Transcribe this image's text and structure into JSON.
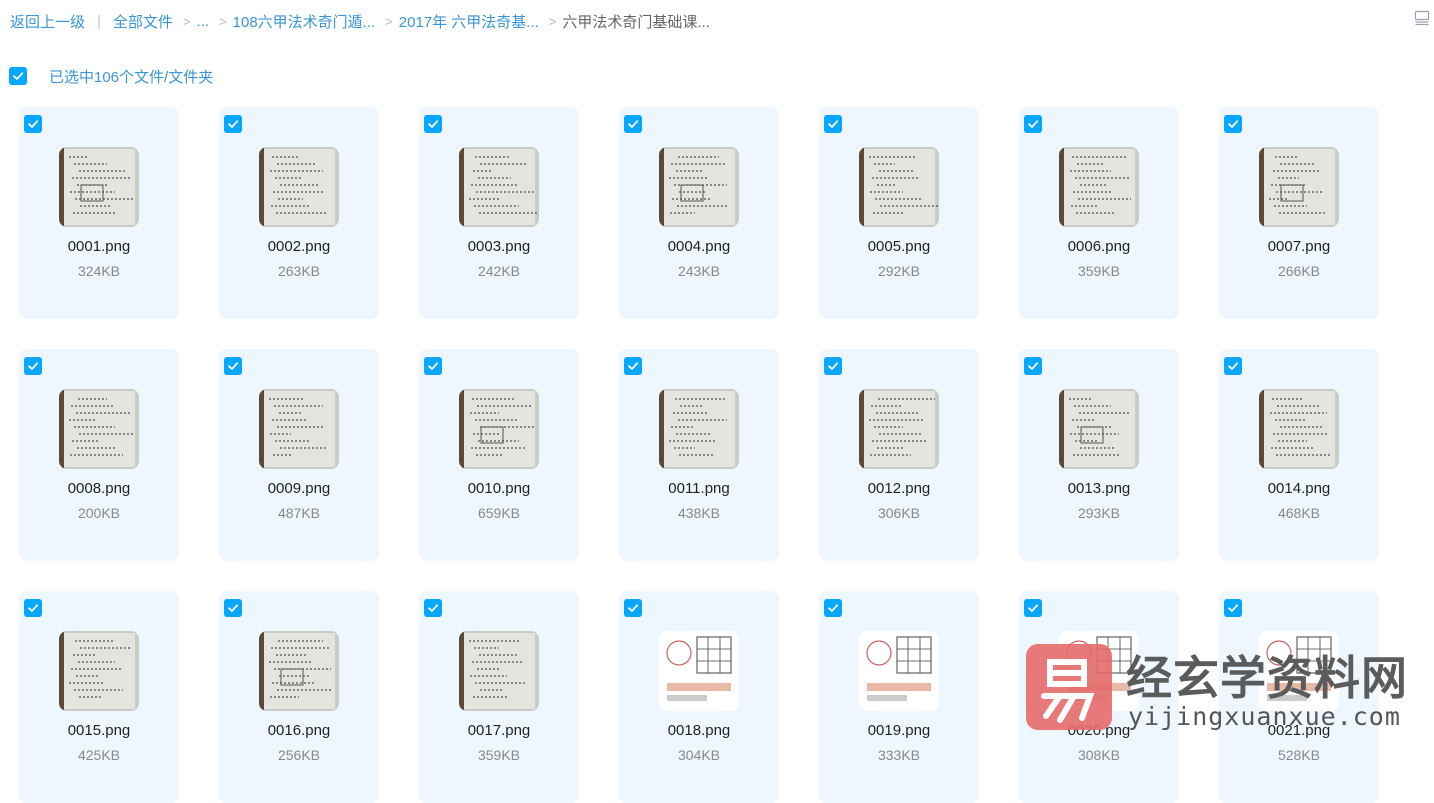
{
  "breadcrumb": {
    "back": "返回上一级",
    "root": "全部文件",
    "ellipsis": "...",
    "folder1": "108六甲法术奇门遁...",
    "folder2": "2017年 六甲法奇基...",
    "current": "六甲法术奇门基础课..."
  },
  "selection": {
    "text": "已选中106个文件/文件夹",
    "checked": true
  },
  "colors": {
    "accent": "#06a7ff",
    "link": "#3b95d6",
    "card_bg": "#eef7ff"
  },
  "icons": {
    "view_toggle": "list-view-icon",
    "check": "checkmark-icon"
  },
  "files": [
    {
      "name": "0001.png",
      "size": "324KB",
      "style": "photo"
    },
    {
      "name": "0002.png",
      "size": "263KB",
      "style": "photo"
    },
    {
      "name": "0003.png",
      "size": "242KB",
      "style": "photo"
    },
    {
      "name": "0004.png",
      "size": "243KB",
      "style": "photo"
    },
    {
      "name": "0005.png",
      "size": "292KB",
      "style": "photo"
    },
    {
      "name": "0006.png",
      "size": "359KB",
      "style": "photo"
    },
    {
      "name": "0007.png",
      "size": "266KB",
      "style": "photo"
    },
    {
      "name": "0008.png",
      "size": "200KB",
      "style": "photo"
    },
    {
      "name": "0009.png",
      "size": "487KB",
      "style": "photo"
    },
    {
      "name": "0010.png",
      "size": "659KB",
      "style": "photo"
    },
    {
      "name": "0011.png",
      "size": "438KB",
      "style": "photo"
    },
    {
      "name": "0012.png",
      "size": "306KB",
      "style": "photo"
    },
    {
      "name": "0013.png",
      "size": "293KB",
      "style": "photo"
    },
    {
      "name": "0014.png",
      "size": "468KB",
      "style": "photo"
    },
    {
      "name": "0015.png",
      "size": "425KB",
      "style": "photo"
    },
    {
      "name": "0016.png",
      "size": "256KB",
      "style": "photo"
    },
    {
      "name": "0017.png",
      "size": "359KB",
      "style": "photo"
    },
    {
      "name": "0018.png",
      "size": "304KB",
      "style": "scan"
    },
    {
      "name": "0019.png",
      "size": "333KB",
      "style": "scan"
    },
    {
      "name": "0020.png",
      "size": "308KB",
      "style": "scan"
    },
    {
      "name": "0021.png",
      "size": "528KB",
      "style": "scan"
    }
  ],
  "watermark": {
    "title": "经玄学资料网",
    "url": "yijingxuanxue.com"
  }
}
